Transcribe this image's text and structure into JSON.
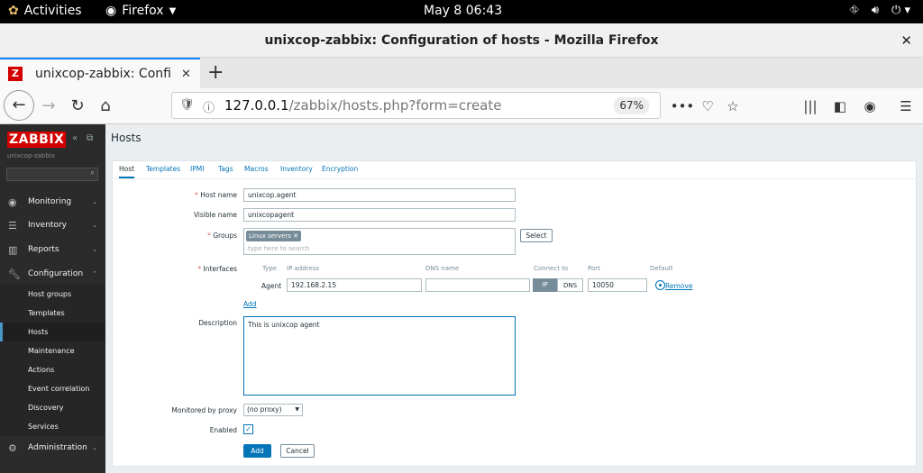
{
  "os": {
    "activities": "Activities",
    "app": "Firefox",
    "clock": "May 8  06:43"
  },
  "window": {
    "title": "unixcop-zabbix: Configuration of hosts - Mozilla Firefox"
  },
  "browser": {
    "tab_title": "unixcop-zabbix: Configuration of hosts",
    "tab_visible": "unixcop-zabbix: Configura",
    "url_host": "127.0.0.1",
    "url_path": "/zabbix/hosts.php?form=create",
    "zoom": "67%"
  },
  "sidebar": {
    "logo": "ZABBIX",
    "server_name": "unixcop-zabbix",
    "menu": [
      {
        "label": "Monitoring"
      },
      {
        "label": "Inventory"
      },
      {
        "label": "Reports"
      },
      {
        "label": "Configuration"
      },
      {
        "label": "Administration"
      }
    ],
    "submenu": [
      {
        "label": "Host groups"
      },
      {
        "label": "Templates"
      },
      {
        "label": "Hosts"
      },
      {
        "label": "Maintenance"
      },
      {
        "label": "Actions"
      },
      {
        "label": "Event correlation"
      },
      {
        "label": "Discovery"
      },
      {
        "label": "Services"
      }
    ]
  },
  "page": {
    "title": "Hosts",
    "tabs": [
      "Host",
      "Templates",
      "IPMI",
      "Tags",
      "Macros",
      "Inventory",
      "Encryption"
    ]
  },
  "form": {
    "host_name_label": "Host name",
    "host_name": "unixcop.agent",
    "visible_name_label": "Visible name",
    "visible_name": "unixcopagent",
    "groups_label": "Groups",
    "group_tag": "Linux servers",
    "groups_placeholder": "type here to search",
    "select_btn": "Select",
    "interfaces_label": "Interfaces",
    "iface_cols": [
      "Type",
      "IP address",
      "DNS name",
      "Connect to",
      "Port",
      "Default"
    ],
    "iface_type": "Agent",
    "iface_ip": "192.168.2.15",
    "iface_dns": "",
    "connect_ip": "IP",
    "connect_dns": "DNS",
    "iface_port": "10050",
    "remove_link": "Remove",
    "add_link": "Add",
    "description_label": "Description",
    "description": "This is unixcop agent",
    "proxy_label": "Monitored by proxy",
    "proxy_value": "(no proxy)",
    "enabled_label": "Enabled",
    "add_btn": "Add",
    "cancel_btn": "Cancel"
  }
}
